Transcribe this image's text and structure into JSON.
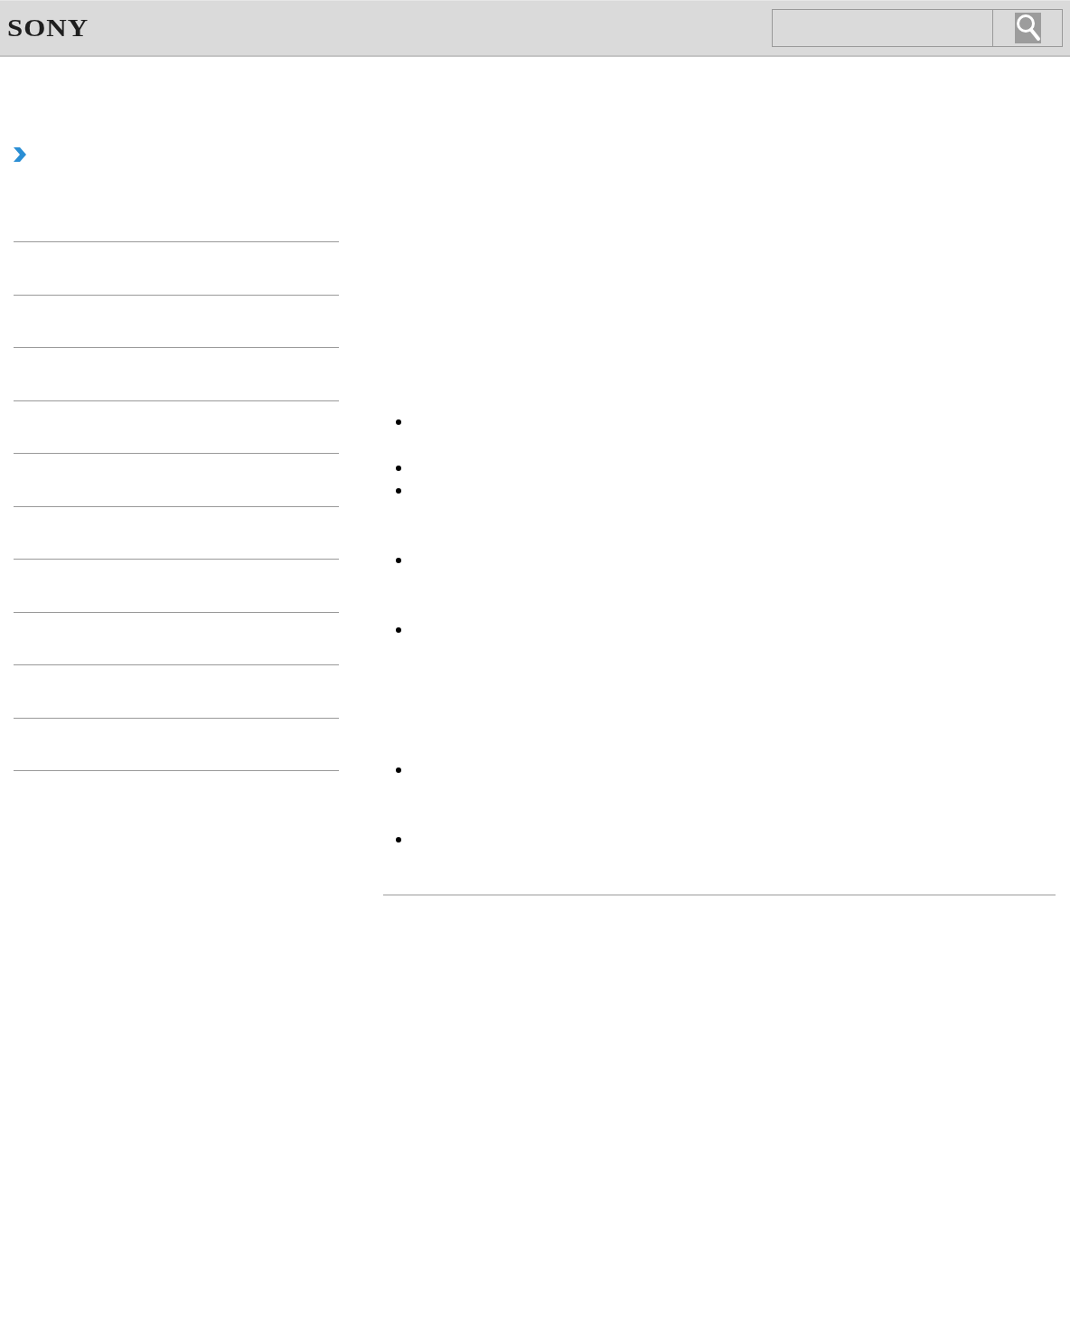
{
  "header": {
    "logo": "SONY",
    "search": {
      "kind": "search"
    }
  },
  "sidebar": {
    "marker": {
      "kind": "chevron"
    },
    "items": [
      {
        "kind": "blank"
      },
      {
        "kind": "blank"
      },
      {
        "kind": "blank"
      },
      {
        "kind": "blank"
      },
      {
        "kind": "blank"
      },
      {
        "kind": "blank"
      },
      {
        "kind": "blank"
      },
      {
        "kind": "blank"
      },
      {
        "kind": "blank"
      },
      {
        "kind": "blank"
      }
    ]
  },
  "content": {
    "bullets": [
      {
        "kind": "bullet"
      },
      {
        "kind": "bullet"
      },
      {
        "kind": "bullet"
      },
      {
        "kind": "bullet"
      },
      {
        "kind": "bullet"
      },
      {
        "kind": "bullet"
      },
      {
        "kind": "bullet"
      }
    ]
  }
}
